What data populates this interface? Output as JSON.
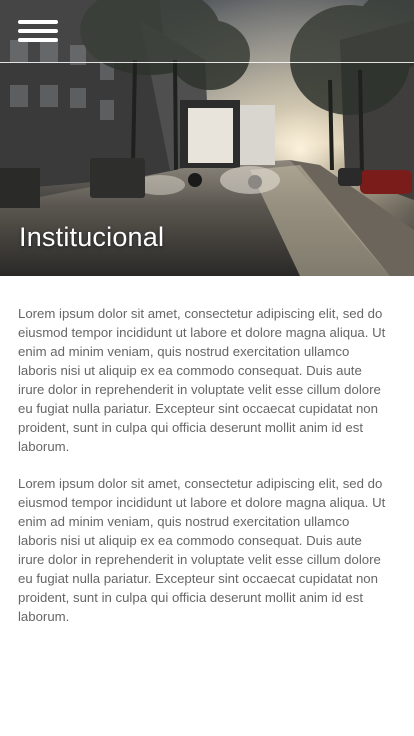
{
  "header": {
    "menu_icon": "hamburger-menu-icon"
  },
  "hero": {
    "title": "Institucional",
    "image_description": "street-with-truck-at-sunrise"
  },
  "content": {
    "paragraphs": [
      "Lorem ipsum dolor sit amet, consectetur adipiscing elit, sed do eiusmod tempor incididunt ut labore et dolore magna aliqua. Ut enim ad minim veniam, quis nostrud exercitation ullamco laboris nisi ut aliquip ex ea commodo consequat. Duis aute irure dolor in reprehenderit in voluptate velit esse cillum dolore eu fugiat nulla pariatur. Excepteur sint occaecat cupidatat non proident, sunt in culpa qui officia deserunt mollit anim id est laborum.",
      "Lorem ipsum dolor sit amet, consectetur adipiscing elit, sed do eiusmod tempor incididunt ut labore et dolore magna aliqua. Ut enim ad minim veniam, quis nostrud exercitation ullamco laboris nisi ut aliquip ex ea commodo consequat. Duis aute irure dolor in reprehenderit in voluptate velit esse cillum dolore eu fugiat nulla pariatur. Excepteur sint occaecat cupidatat non proident, sunt in culpa qui officia deserunt mollit anim id est laborum."
    ]
  },
  "colors": {
    "text": "#666666",
    "title": "#ffffff",
    "background": "#ffffff"
  }
}
